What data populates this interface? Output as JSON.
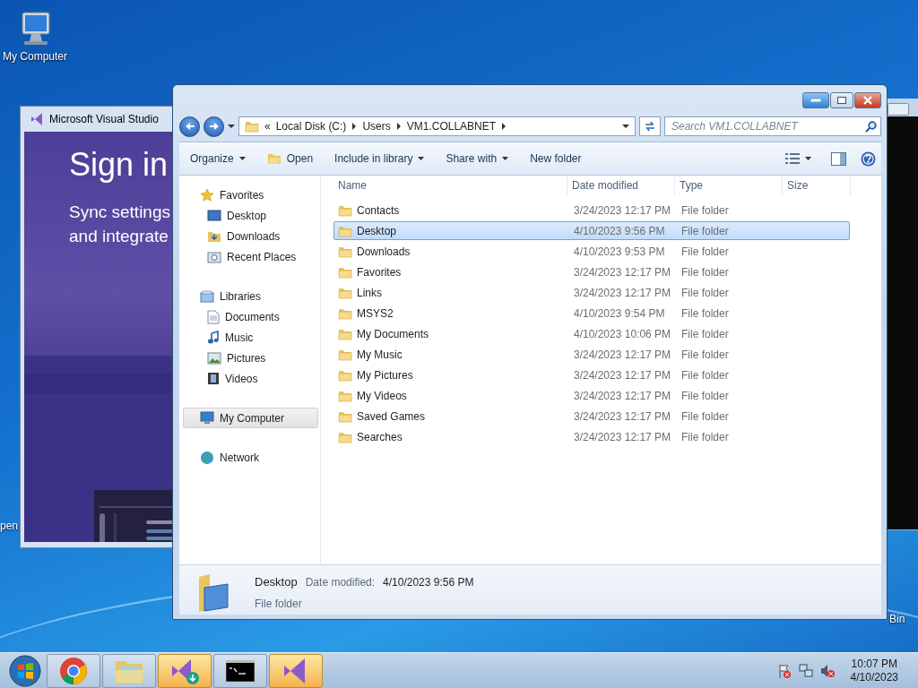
{
  "desktop": {
    "icons": [
      {
        "label": "My Computer"
      }
    ],
    "fragments": [
      {
        "text": "pen"
      },
      {
        "text": "Bin"
      }
    ]
  },
  "vs_window": {
    "title": "Microsoft Visual Studio",
    "heading": "Sign in",
    "text_lines": [
      "Sync settings",
      "and integrate"
    ]
  },
  "explorer": {
    "breadcrumb": [
      "«",
      "Local Disk (C:)",
      "Users",
      "VM1.COLLABNET"
    ],
    "search": {
      "placeholder": "Search VM1.COLLABNET"
    },
    "toolbar": [
      {
        "label": "Organize",
        "dropdown": true
      },
      {
        "label": "Open",
        "dropdown": false
      },
      {
        "label": "Include in library",
        "dropdown": true
      },
      {
        "label": "Share with",
        "dropdown": true
      },
      {
        "label": "New folder",
        "dropdown": false
      }
    ],
    "nav": [
      {
        "label": "Favorites",
        "selected": false,
        "children": [
          {
            "label": "Desktop",
            "selected": false
          },
          {
            "label": "Downloads",
            "selected": false
          },
          {
            "label": "Recent Places",
            "selected": false
          }
        ]
      },
      {
        "label": "Libraries",
        "selected": false,
        "children": [
          {
            "label": "Documents",
            "selected": false
          },
          {
            "label": "Music",
            "selected": false
          },
          {
            "label": "Pictures",
            "selected": false
          },
          {
            "label": "Videos",
            "selected": false
          }
        ]
      },
      {
        "label": "My Computer",
        "selected": true
      },
      {
        "label": "Network",
        "selected": false
      }
    ],
    "columns": [
      "Name",
      "Date modified",
      "Type",
      "Size"
    ],
    "rows": [
      {
        "name": "Contacts",
        "date": "3/24/2023 12:17 PM",
        "type": "File folder",
        "selected": false
      },
      {
        "name": "Desktop",
        "date": "4/10/2023 9:56 PM",
        "type": "File folder",
        "selected": true
      },
      {
        "name": "Downloads",
        "date": "4/10/2023 9:53 PM",
        "type": "File folder",
        "selected": false
      },
      {
        "name": "Favorites",
        "date": "3/24/2023 12:17 PM",
        "type": "File folder",
        "selected": false
      },
      {
        "name": "Links",
        "date": "3/24/2023 12:17 PM",
        "type": "File folder",
        "selected": false
      },
      {
        "name": "MSYS2",
        "date": "4/10/2023 9:54 PM",
        "type": "File folder",
        "selected": false
      },
      {
        "name": "My Documents",
        "date": "4/10/2023 10:06 PM",
        "type": "File folder",
        "selected": false
      },
      {
        "name": "My Music",
        "date": "3/24/2023 12:17 PM",
        "type": "File folder",
        "selected": false
      },
      {
        "name": "My Pictures",
        "date": "3/24/2023 12:17 PM",
        "type": "File folder",
        "selected": false
      },
      {
        "name": "My Videos",
        "date": "3/24/2023 12:17 PM",
        "type": "File folder",
        "selected": false
      },
      {
        "name": "Saved Games",
        "date": "3/24/2023 12:17 PM",
        "type": "File folder",
        "selected": false
      },
      {
        "name": "Searches",
        "date": "3/24/2023 12:17 PM",
        "type": "File folder",
        "selected": false
      }
    ],
    "details": {
      "name": "Desktop",
      "label": "Date modified:",
      "value": "4/10/2023 9:56 PM",
      "type": "File folder"
    }
  },
  "taskbar": {
    "apps": [
      {
        "kind": "chrome",
        "active": false
      },
      {
        "kind": "explorer",
        "active": false
      },
      {
        "kind": "vs-installer",
        "active": true
      },
      {
        "kind": "terminal",
        "active": false
      },
      {
        "kind": "vs",
        "active": true
      }
    ],
    "clock": {
      "time": "10:07 PM",
      "date": "4/10/2023"
    }
  }
}
